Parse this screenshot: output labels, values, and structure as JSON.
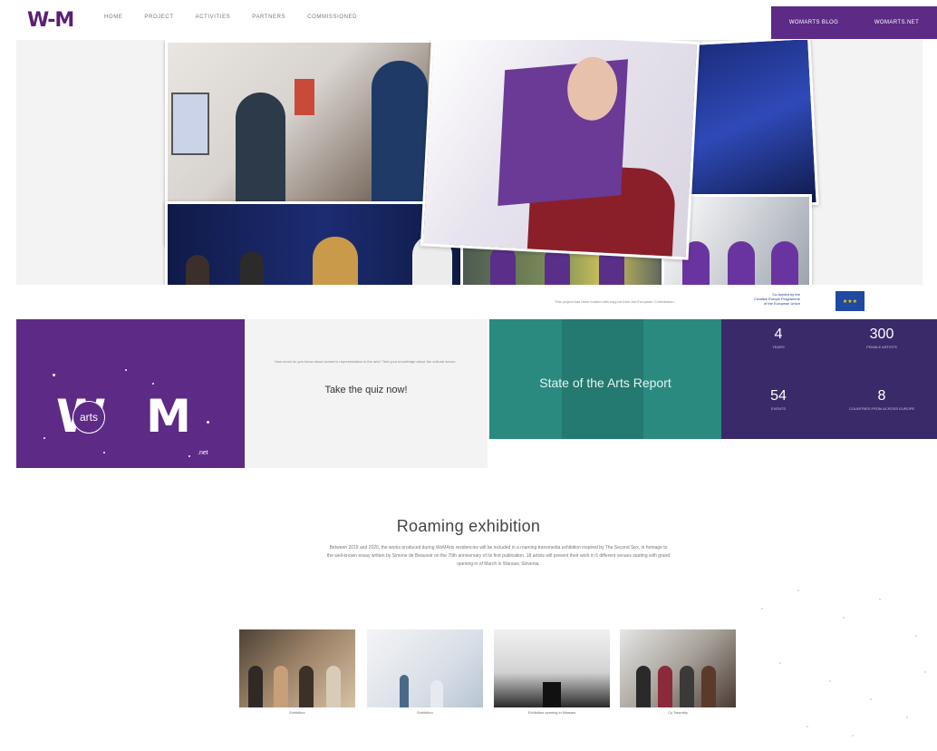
{
  "header": {
    "logo": "W-M",
    "nav": [
      "HOME",
      "PROJECT",
      "ACTIVITIES",
      "PARTNERS",
      "COMMISSIONED"
    ],
    "cta": [
      "WOMARTS BLOG",
      "WOMARTS.NET"
    ]
  },
  "eu": {
    "text": "This project has been funded with support from the European Commission.",
    "cofunded": [
      "Co-funded by the",
      "Creative Europe Programme",
      "of the European Union"
    ]
  },
  "logo_panel": {
    "big_left": "W",
    "arts": "arts",
    "big_right": "M",
    "net": ".net"
  },
  "quiz": {
    "small": "How much do you know about women's representation in the arts? Test your knowledge about the cultural sector.",
    "cta": "Take the quiz now!"
  },
  "report": {
    "title": "State of the Arts Report"
  },
  "stats": [
    {
      "num": "4",
      "label": "YEARS"
    },
    {
      "num": "300",
      "label": "FEMALE ARTISTS"
    },
    {
      "num": "54",
      "label": "EVENTS"
    },
    {
      "num": "8",
      "label": "COUNTRIES FROM ACROSS EUROPE"
    }
  ],
  "exhibition": {
    "title": "Roaming exhibition",
    "body": "Between 2019 and 2020, the works produced during WoMArts residencies will be included in a roaming transmedia exhibition inspired by The Second Sex, in homage to the well-known essay written by Simone de Beauvoir on the 70th anniversary of its first publication. 18 artists will present their work in 6 different venues starting with grand opening in of March in Warsaw, Slovenia.",
    "captions": [
      "Exhibition",
      "Exhibition",
      "Exhibition opening in Warsaw",
      "Cy Twombly"
    ]
  },
  "colors": {
    "purple": "#5d2a86",
    "teal": "#2a8a80",
    "navy": "#3b2a6a",
    "eu_blue": "#1f49a3"
  }
}
